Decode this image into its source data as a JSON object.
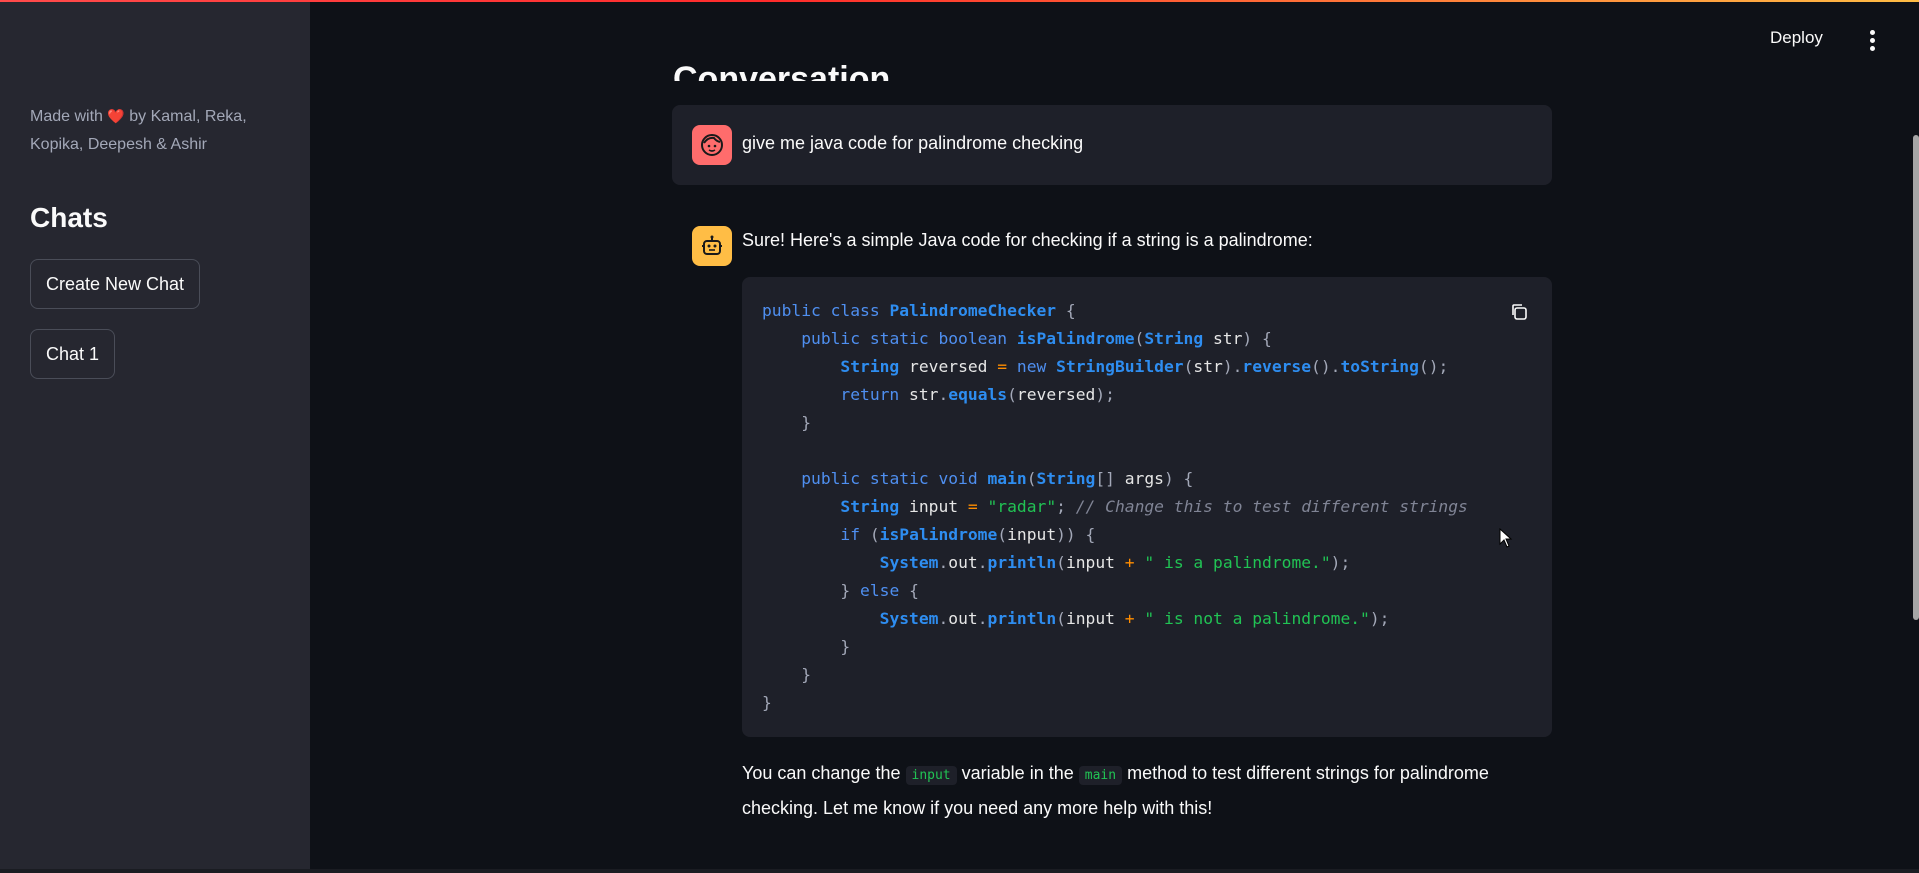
{
  "sidebar": {
    "made_with_prefix": "Made with",
    "heart": "❤️",
    "made_with_suffix": "by Kamal, Reka, Kopika, Deepesh & Ashir",
    "chats_heading": "Chats",
    "buttons": [
      {
        "label": "Create New Chat"
      },
      {
        "label": "Chat 1"
      }
    ]
  },
  "header": {
    "deploy_label": "Deploy",
    "menu_icon": "more-vert-icon"
  },
  "main": {
    "page_title": "Conversation",
    "user_message": {
      "avatar_icon": "user-face-icon",
      "text": "give me java code for palindrome checking"
    },
    "assistant_message": {
      "avatar_icon": "robot-icon",
      "intro": "Sure! Here's a simple Java code for checking if a string is a palindrome:",
      "copy_icon": "copy-icon",
      "outro_1": "You can change the",
      "outro_code_1": "input",
      "outro_2": "variable in the",
      "outro_code_2": "main",
      "outro_3": "method to test different strings for palindrome checking. Let me know if you need any more help with this!"
    }
  },
  "colors": {
    "background": "#0e1117",
    "sidebar": "#262730",
    "accent": "#ff4b4b",
    "code_keyword": "#4f8ff0",
    "code_string": "#21c354",
    "code_comment": "#808495",
    "code_operator": "#ff8c00"
  }
}
